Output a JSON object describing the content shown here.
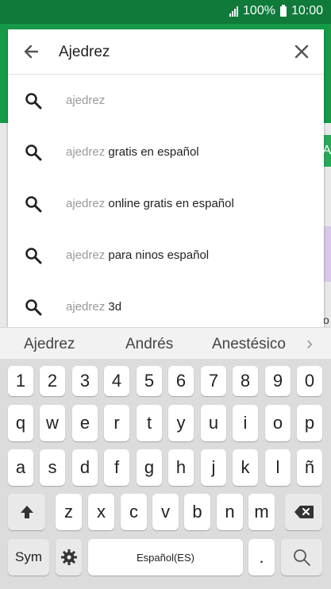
{
  "status": {
    "battery": "100%",
    "time": "10:00"
  },
  "search": {
    "query": "Ajedrez",
    "suggestions": [
      {
        "prefix": "ajedrez",
        "rest": ""
      },
      {
        "prefix": "ajedrez",
        "rest": " gratis en español"
      },
      {
        "prefix": "ajedrez",
        "rest": " online gratis en español"
      },
      {
        "prefix": "ajedrez",
        "rest": " para ninos español"
      },
      {
        "prefix": "ajedrez",
        "rest": " 3d"
      }
    ]
  },
  "background": {
    "partial_letter": "A",
    "partial_letter2": "o"
  },
  "keyboard": {
    "predictions": [
      "Ajedrez",
      "Andrés",
      "Anestésico"
    ],
    "more_arrow": "›",
    "numbers": [
      "1",
      "2",
      "3",
      "4",
      "5",
      "6",
      "7",
      "8",
      "9",
      "0"
    ],
    "row1": [
      "q",
      "w",
      "e",
      "r",
      "t",
      "y",
      "u",
      "i",
      "o",
      "p"
    ],
    "row2": [
      "a",
      "s",
      "d",
      "f",
      "g",
      "h",
      "j",
      "k",
      "l",
      "ñ"
    ],
    "row3": [
      "z",
      "x",
      "c",
      "v",
      "b",
      "n",
      "m"
    ],
    "sym_label": "Sym",
    "space_label": "Español(ES)",
    "period": "."
  },
  "colors": {
    "statusbar": "#0f7a3a",
    "appbar": "#159a48"
  }
}
